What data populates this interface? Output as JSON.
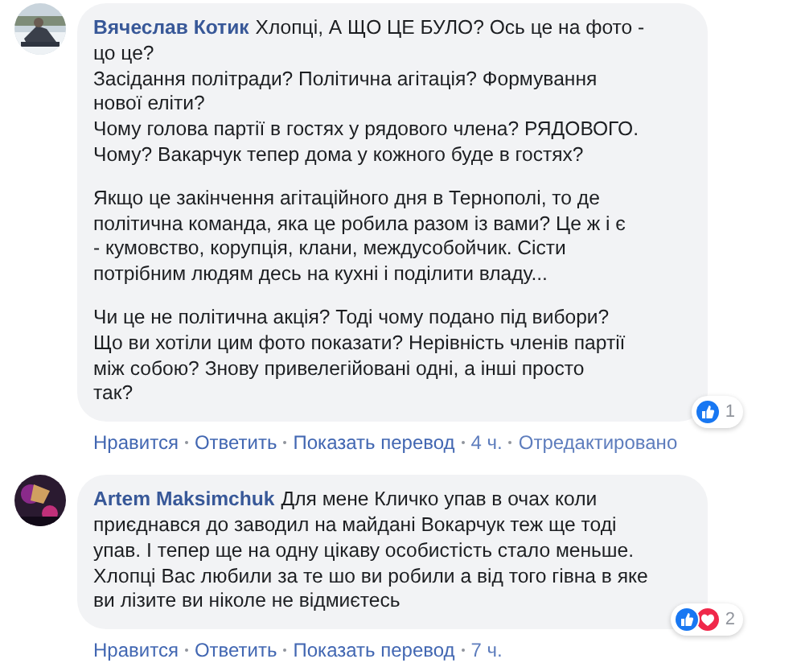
{
  "comments": [
    {
      "avatar": {
        "kind": "picture"
      },
      "author": "Вячеслав Котик",
      "paragraphs": [
        [
          "Хлопці, А ЩО ЦЕ БУЛО? Ось це на фото -",
          "цо це?",
          "Засідання політради? Політична агітація? Формування",
          "нової еліти?",
          "Чому голова партії в гостях у рядового члена? РЯДОВОГО.",
          "Чому? Вакарчук тепер дома у кожного буде в гостях?"
        ],
        [
          "Якщо це закінчення агітаційного дня в Тернополі, то де",
          "політична команда, яка це робила разом із вами? Це ж і є",
          "- кумовство, корупція, клани, междусобойчик. Сісти",
          "потрібним людям десь на кухні і поділити владу..."
        ],
        [
          "Чи це не політична акція? Тоді чому подано під вибори?",
          "Що ви хотіли цим фото показати? Нерівність членів партії",
          "між собою? Знову привелегійовані одні, а інші просто",
          "так?"
        ]
      ],
      "reactions": {
        "icons": [
          {
            "kind": "like"
          }
        ],
        "count": "1"
      },
      "actions": [
        {
          "text": "Нравится",
          "kind": "link"
        },
        {
          "text": "Ответить",
          "kind": "link"
        },
        {
          "text": "Показать перевод",
          "kind": "link"
        },
        {
          "text": "4 ч.",
          "kind": "meta"
        },
        {
          "text": "Отредактировано",
          "kind": "meta"
        }
      ]
    },
    {
      "avatar": {
        "kind": "picture"
      },
      "author": "Artem Maksimchuk",
      "paragraphs": [
        [
          "Для мене Кличко упав в очах коли",
          "приєднався до заводил на майдані Вокарчук теж ще тоді",
          "упав. І тепер ще на одну цікаву особистість стало меньше.",
          "Хлопці Вас любили за те шо ви робили а від того гівна в яке",
          "ви лізите ви ніколе не відмиєтесь"
        ]
      ],
      "reactions": {
        "icons": [
          {
            "kind": "like"
          },
          {
            "kind": "love"
          }
        ],
        "count": "2"
      },
      "actions": [
        {
          "text": "Нравится",
          "kind": "link"
        },
        {
          "text": "Ответить",
          "kind": "link"
        },
        {
          "text": "Показать перевод",
          "kind": "link"
        },
        {
          "text": "7 ч.",
          "kind": "meta"
        }
      ]
    }
  ]
}
